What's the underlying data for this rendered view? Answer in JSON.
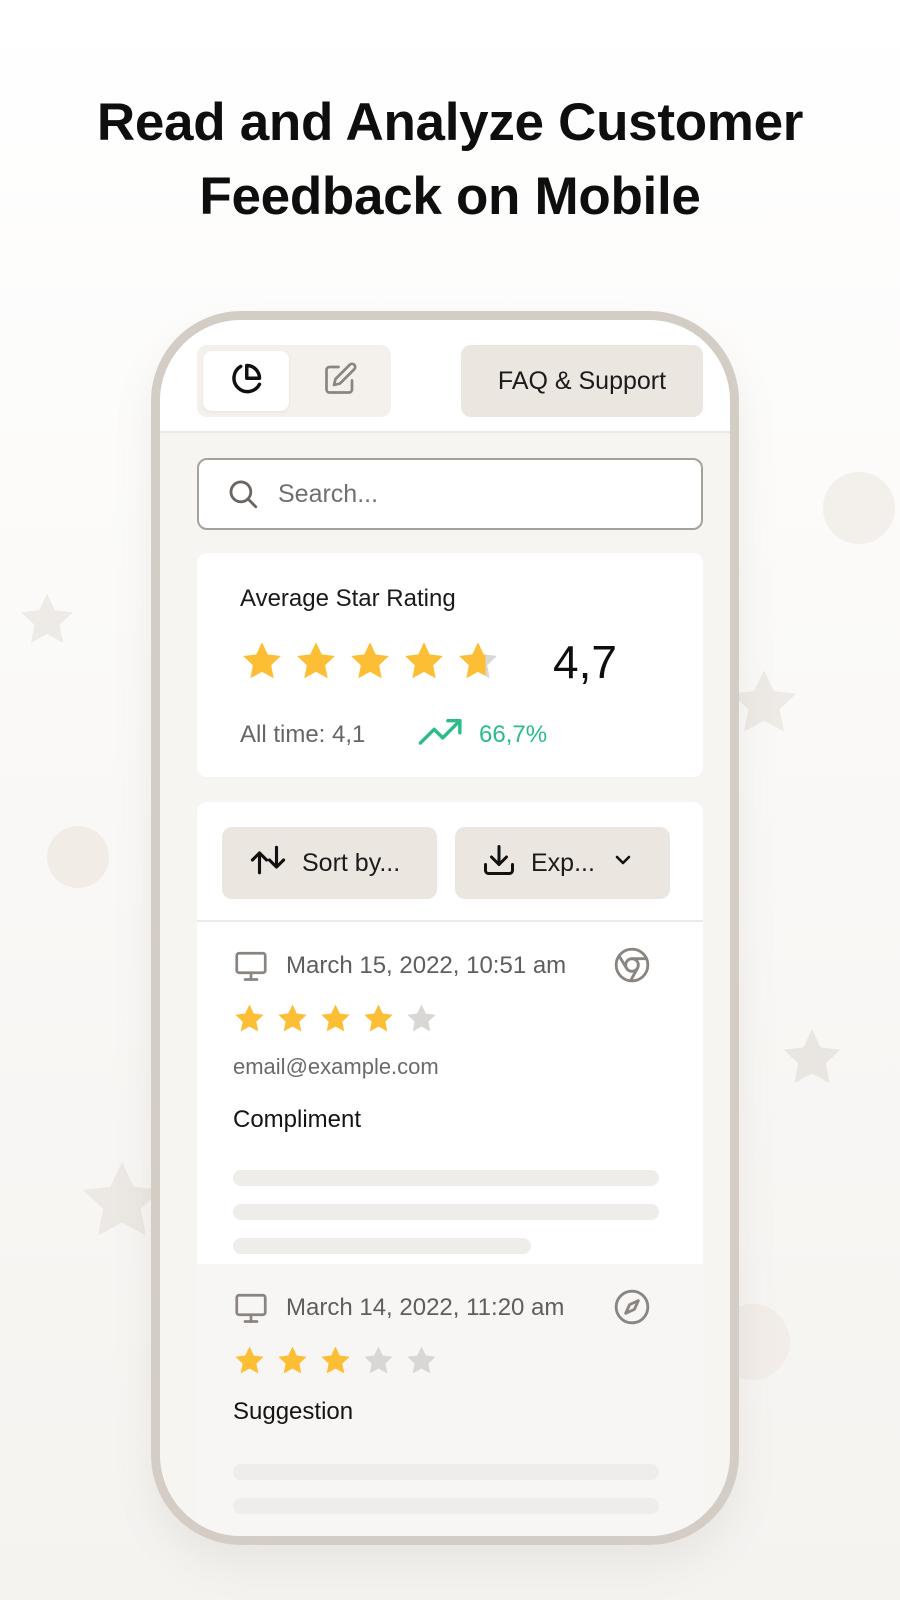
{
  "headline": {
    "line1": "Read and Analyze Customer",
    "line2": "Feedback on Mobile"
  },
  "colors": {
    "star_filled": "#FBBE35",
    "star_empty": "#D9D6D3",
    "trend_green": "#2BBB8C",
    "phone_frame": "#D4CDC5",
    "button_bg": "#EBE6E0"
  },
  "topbar": {
    "tabs": [
      {
        "icon": "pie-chart-icon",
        "selected": true
      },
      {
        "icon": "edit-icon",
        "selected": false
      }
    ],
    "faq_label": "FAQ & Support"
  },
  "search": {
    "placeholder": "Search...",
    "icon": "search-icon"
  },
  "rating_card": {
    "title": "Average Star Rating",
    "stars": 4.7,
    "value": "4,7",
    "all_time": "All time: 4,1",
    "trend_icon": "trending-up-icon",
    "trend": "66,7%"
  },
  "toolbar": {
    "sort_label": "Sort by...",
    "sort_icon": "sort-arrows-icon",
    "export_label": "Exp...",
    "export_icon": "download-icon"
  },
  "reviews": [
    {
      "device_icon": "monitor-icon",
      "date": "March 15, 2022, 10:51 am",
      "browser_icon": "chrome-icon",
      "stars": 4,
      "email": "email@example.com",
      "category": "Compliment"
    },
    {
      "device_icon": "monitor-icon",
      "date": "March 14, 2022, 11:20 am",
      "browser_icon": "safari-icon",
      "stars": 3,
      "category": "Suggestion"
    }
  ]
}
